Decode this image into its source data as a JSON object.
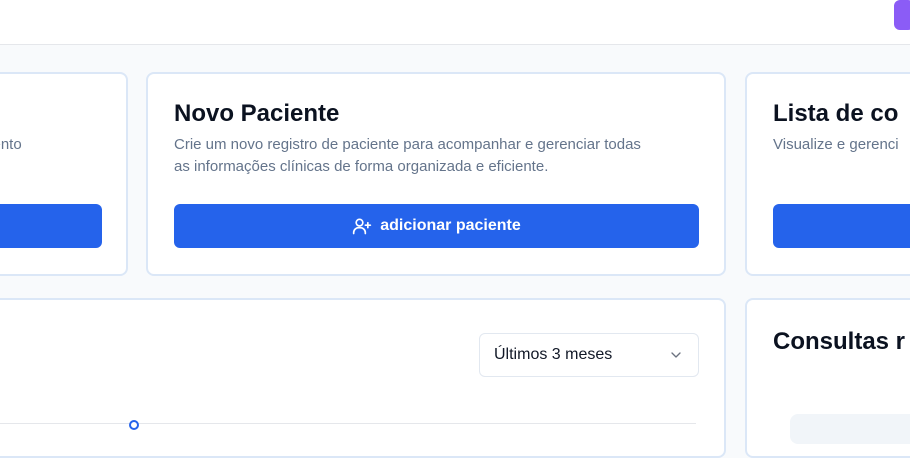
{
  "cards": {
    "left_partial": {
      "desc_tail": "mento"
    },
    "new_patient": {
      "title": "Novo Paciente",
      "desc_line1": "Crie um novo registro de paciente para acompanhar e gerenciar todas",
      "desc_line2": "as informações clínicas de forma organizada e eficiente.",
      "button_label": "adicionar paciente",
      "button_icon": "user-plus-icon"
    },
    "list_partial": {
      "title": "Lista de co",
      "desc": "Visualize e gerenci"
    }
  },
  "chart_panel": {
    "period_select": {
      "value": "Últimos 3 meses"
    }
  },
  "consultations_panel": {
    "title": "Consultas r"
  },
  "colors": {
    "primary": "#2563eb",
    "accent": "#8b5cf6",
    "card_border": "#dbe7f7",
    "muted_text": "#64748b"
  }
}
